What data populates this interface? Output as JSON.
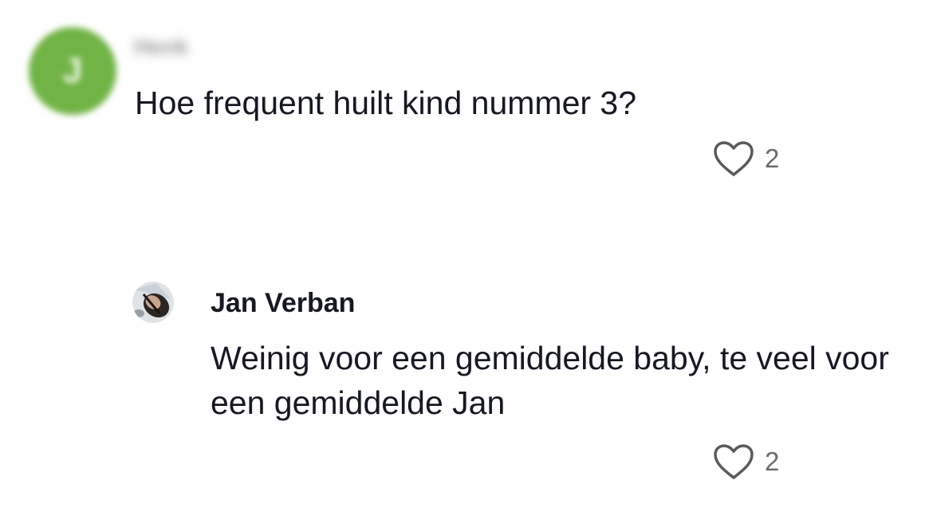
{
  "comment": {
    "avatar_initial": "J",
    "username": "Henk",
    "text": "Hoe frequent huilt kind nummer 3?",
    "likes": "2"
  },
  "reply": {
    "author": "Jan Verban",
    "text": "Weinig voor een gemiddelde baby, te veel voor een gemiddelde Jan",
    "likes": "2"
  },
  "colors": {
    "avatar_bg": "#71b445",
    "text": "#161823",
    "muted": "#6b6b6b"
  }
}
